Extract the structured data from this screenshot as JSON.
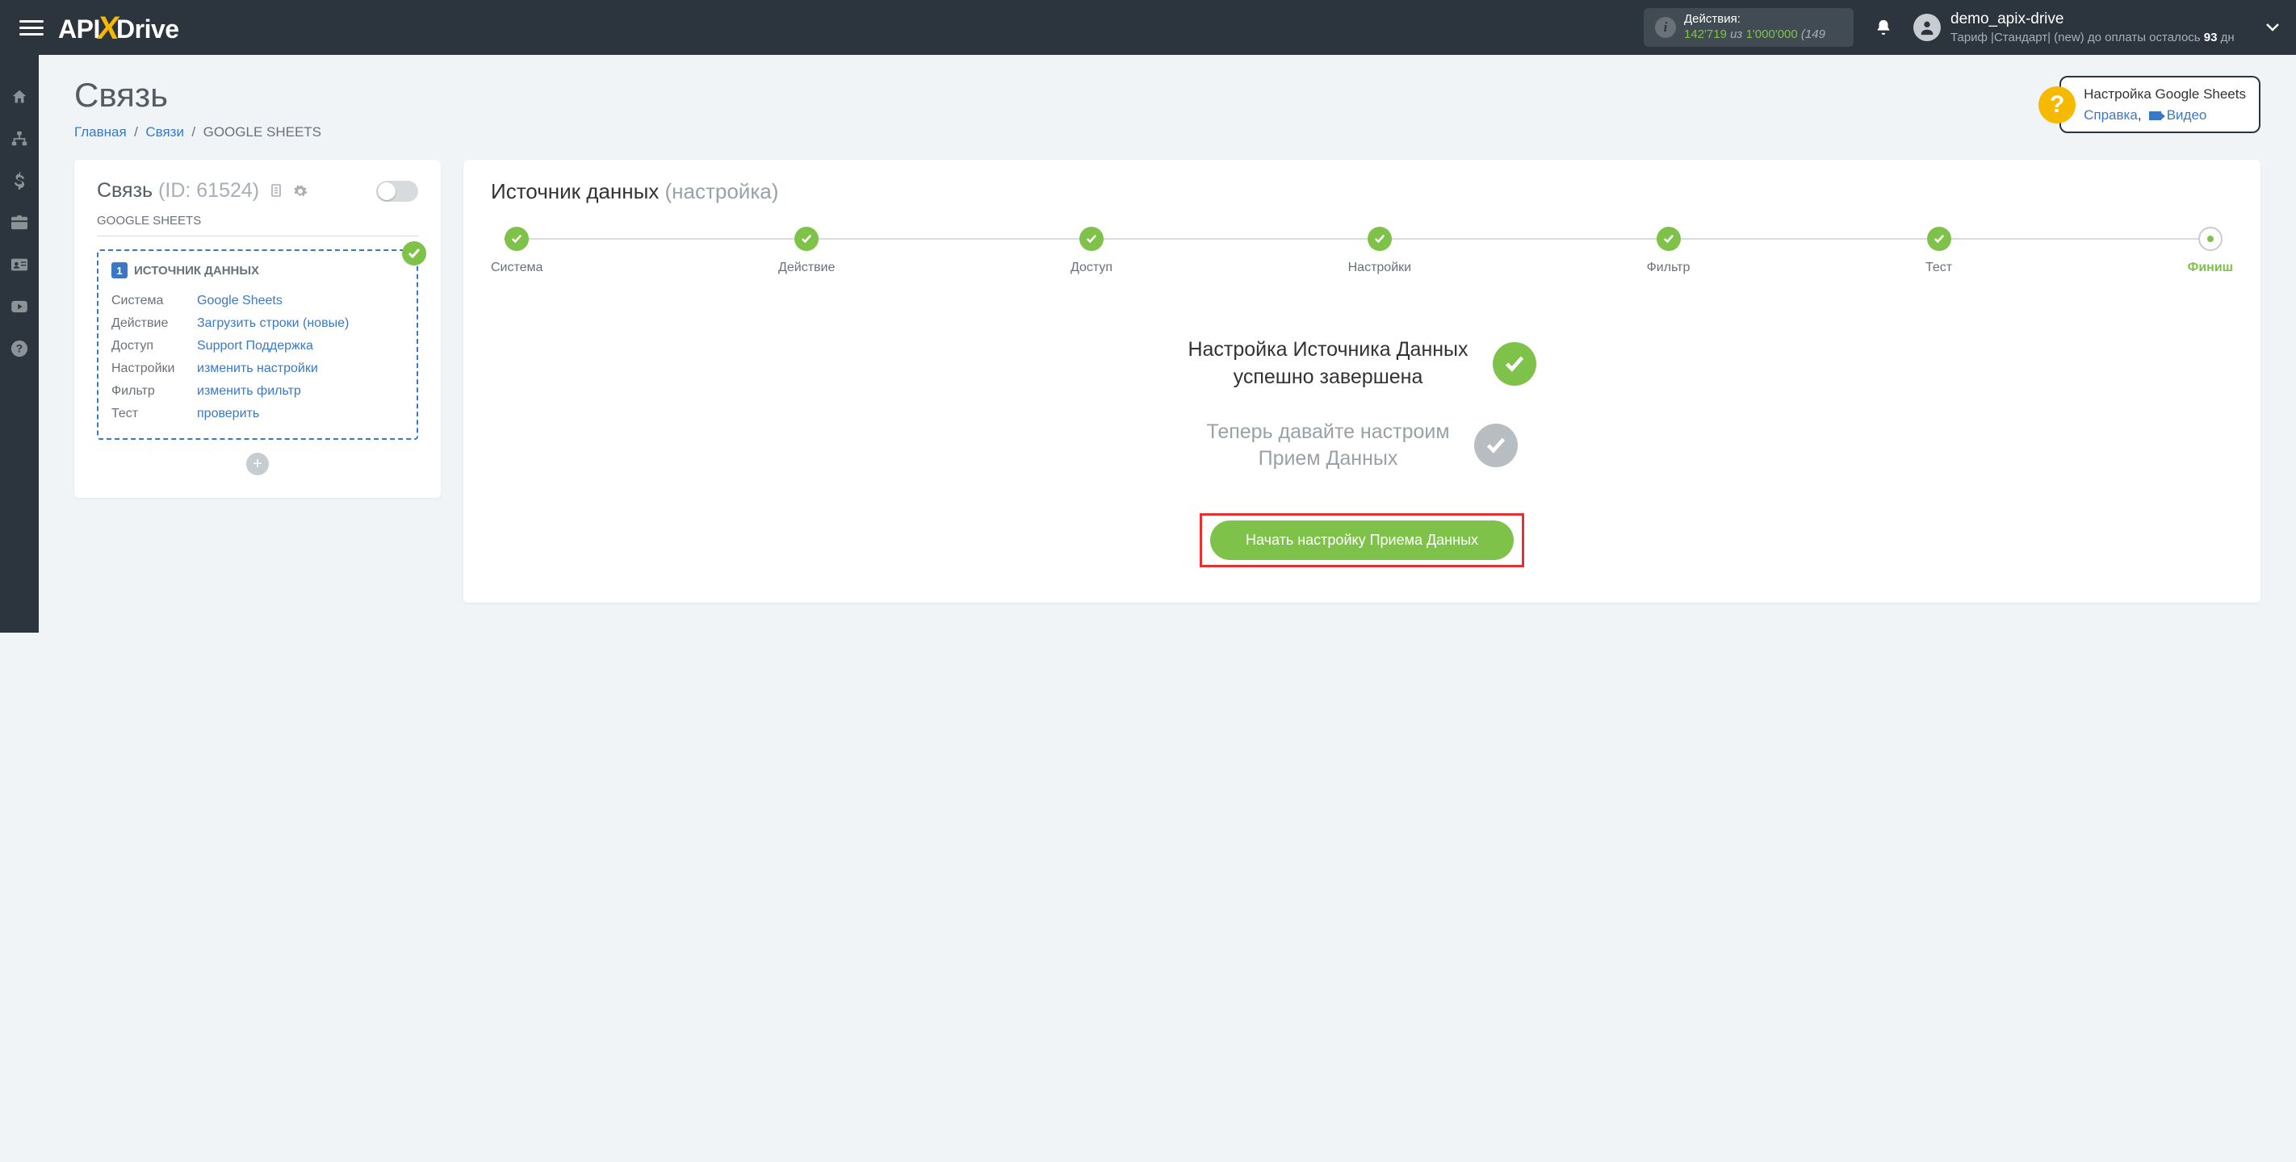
{
  "header": {
    "actions_label": "Действия:",
    "actions_used": "142'719",
    "actions_of": "из",
    "actions_total": "1'000'000",
    "actions_tail": "(149",
    "username": "demo_apix-drive",
    "tariff_line_a": "Тариф |Стандарт| (new) до оплаты осталось ",
    "tariff_days": "93",
    "tariff_line_b": " дн"
  },
  "page": {
    "title": "Связь",
    "crumb_home": "Главная",
    "crumb_links": "Связи",
    "crumb_current": "GOOGLE SHEETS"
  },
  "help": {
    "title": "Настройка Google Sheets",
    "link1": "Справка",
    "link2": "Видео"
  },
  "left": {
    "head": "Связь",
    "id_label": "(ID: 61524)",
    "subtitle": "GOOGLE SHEETS",
    "box_title": "ИСТОЧНИК ДАННЫХ",
    "box_num": "1",
    "rows": {
      "k0": "Система",
      "v0": "Google Sheets",
      "k1": "Действие",
      "v1": "Загрузить строки (новые)",
      "k2": "Доступ",
      "v2": "Support Поддержка",
      "k3": "Настройки",
      "v3": "изменить настройки",
      "k4": "Фильтр",
      "v4": "изменить фильтр",
      "k5": "Тест",
      "v5": "проверить"
    }
  },
  "right": {
    "title_a": "Источник данных",
    "title_b": "(настройка)",
    "steps": {
      "s0": "Система",
      "s1": "Действие",
      "s2": "Доступ",
      "s3": "Настройки",
      "s4": "Фильтр",
      "s5": "Тест",
      "s6": "Финиш"
    },
    "msg1_a": "Настройка Источника Данных",
    "msg1_b": "успешно завершена",
    "msg2_a": "Теперь давайте настроим",
    "msg2_b": "Прием Данных",
    "cta": "Начать настройку Приема Данных"
  }
}
